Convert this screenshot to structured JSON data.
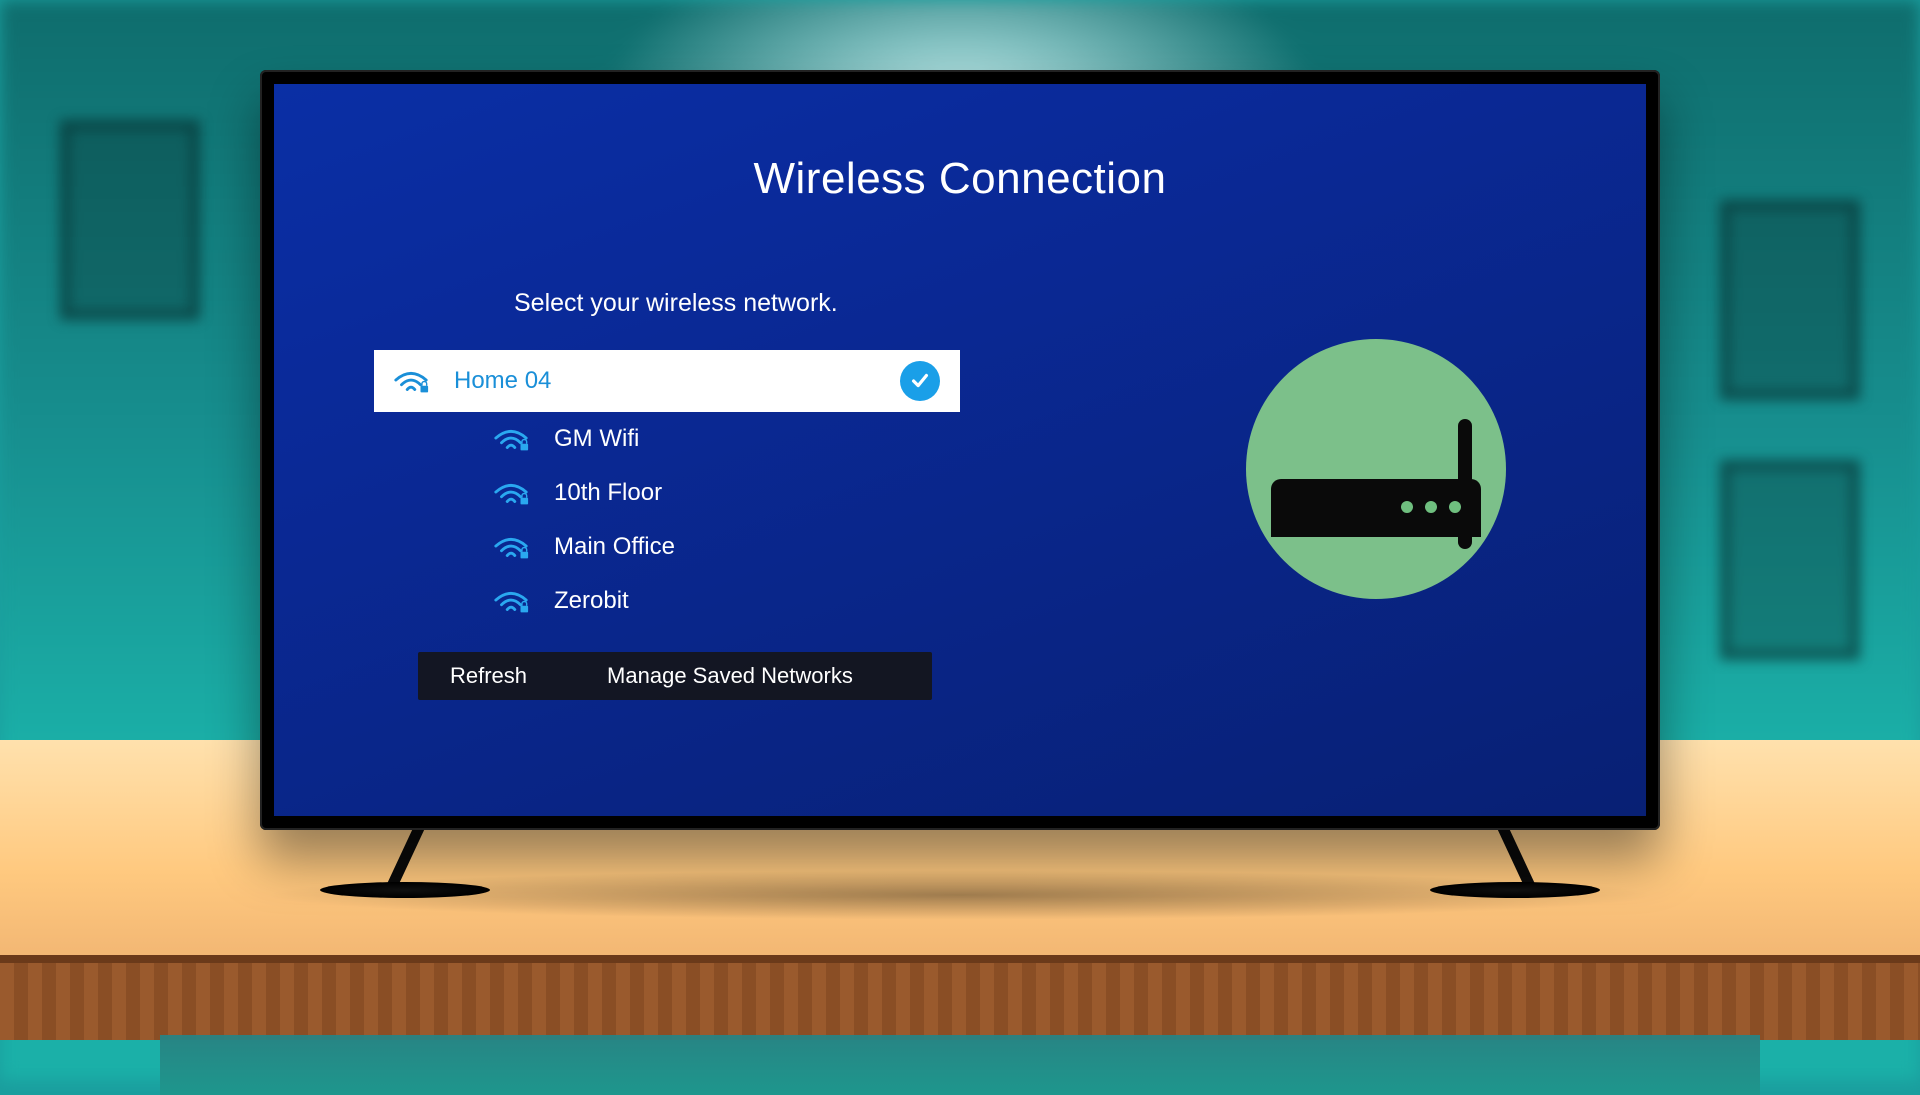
{
  "title": "Wireless Connection",
  "subtitle": "Select your wireless network.",
  "networks": [
    {
      "name": "Home 04",
      "selected": true
    },
    {
      "name": "GM Wifi",
      "selected": false
    },
    {
      "name": "10th Floor",
      "selected": false
    },
    {
      "name": "Main Office",
      "selected": false
    },
    {
      "name": "Zerobit",
      "selected": false
    }
  ],
  "buttons": {
    "refresh": "Refresh",
    "manage": "Manage Saved Networks"
  },
  "colors": {
    "screen_bg": "#082074",
    "accent": "#1a9fe8",
    "router_bg": "#7cc08a"
  }
}
